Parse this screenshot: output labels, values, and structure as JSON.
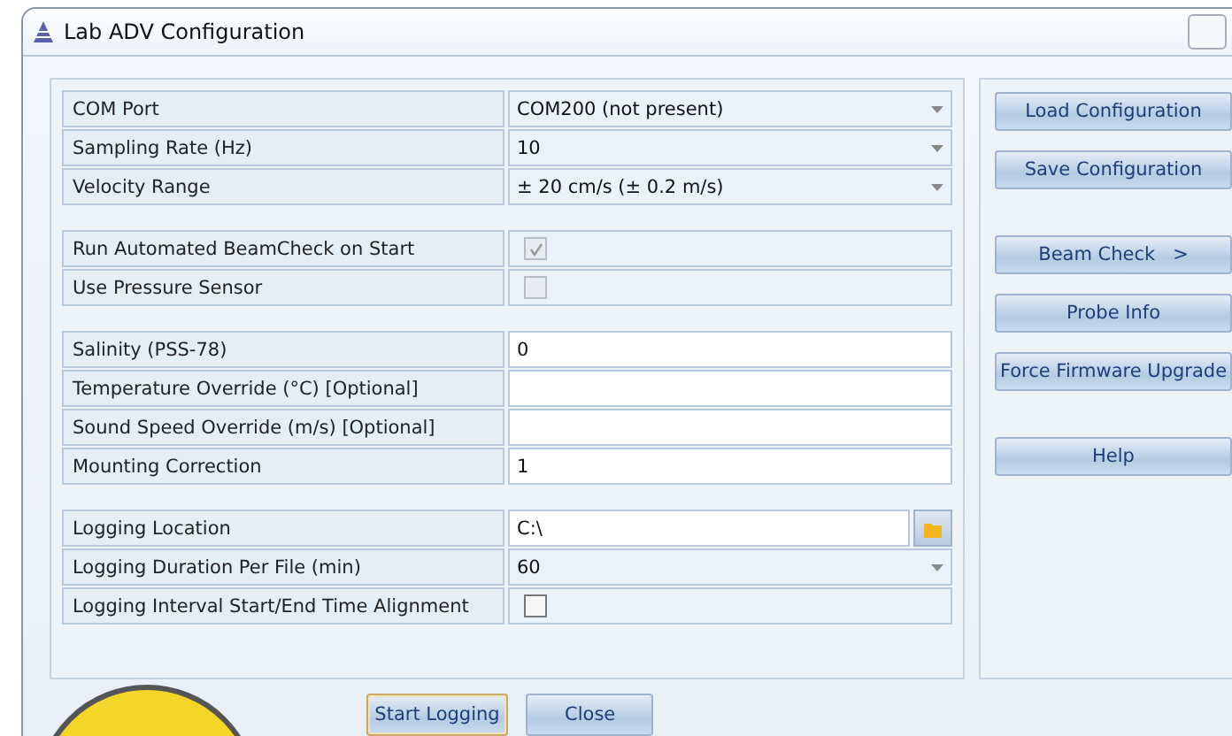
{
  "window": {
    "title": "Lab ADV Configuration"
  },
  "groups": [
    {
      "rows": [
        {
          "label": "COM Port",
          "kind": "dropdown",
          "value": "COM200 (not present)"
        },
        {
          "label": "Sampling Rate (Hz)",
          "kind": "dropdown",
          "value": "10"
        },
        {
          "label": "Velocity Range",
          "kind": "dropdown",
          "value": "± 20 cm/s (± 0.2 m/s)"
        }
      ]
    },
    {
      "rows": [
        {
          "label": "Run Automated BeamCheck on Start",
          "kind": "checkbox",
          "checked": true,
          "disabled": true
        },
        {
          "label": "Use Pressure Sensor",
          "kind": "checkbox",
          "checked": false,
          "disabled": true
        }
      ]
    },
    {
      "rows": [
        {
          "label": "Salinity (PSS-78)",
          "kind": "text",
          "value": "0"
        },
        {
          "label": "Temperature Override (°C)  [Optional]",
          "kind": "text"
        },
        {
          "label": "Sound Speed Override (m/s)  [Optional]",
          "kind": "text"
        },
        {
          "label": "Mounting Correction",
          "kind": "text",
          "value": "1"
        }
      ]
    },
    {
      "rows": [
        {
          "label": "Logging Location",
          "kind": "folder",
          "value": "C:\\"
        },
        {
          "label": "Logging Duration Per File (min)",
          "kind": "dropdown",
          "value": "60"
        },
        {
          "label": "Logging Interval Start/End Time Alignment",
          "kind": "checkbox",
          "checked": false,
          "disabled": false
        }
      ]
    }
  ],
  "side_buttons": [
    {
      "group": [
        {
          "label": "Load Configuration"
        },
        {
          "label": "Save Configuration"
        }
      ]
    },
    {
      "group": [
        {
          "label": "Beam Check   >"
        },
        {
          "label": "Probe Info"
        },
        {
          "label": "Force Firmware Upgrade"
        }
      ]
    },
    {
      "group": [
        {
          "label": "Help"
        }
      ]
    }
  ],
  "footer_buttons": [
    {
      "label": "Start Logging",
      "default": true
    },
    {
      "label": "Close",
      "default": false
    }
  ]
}
